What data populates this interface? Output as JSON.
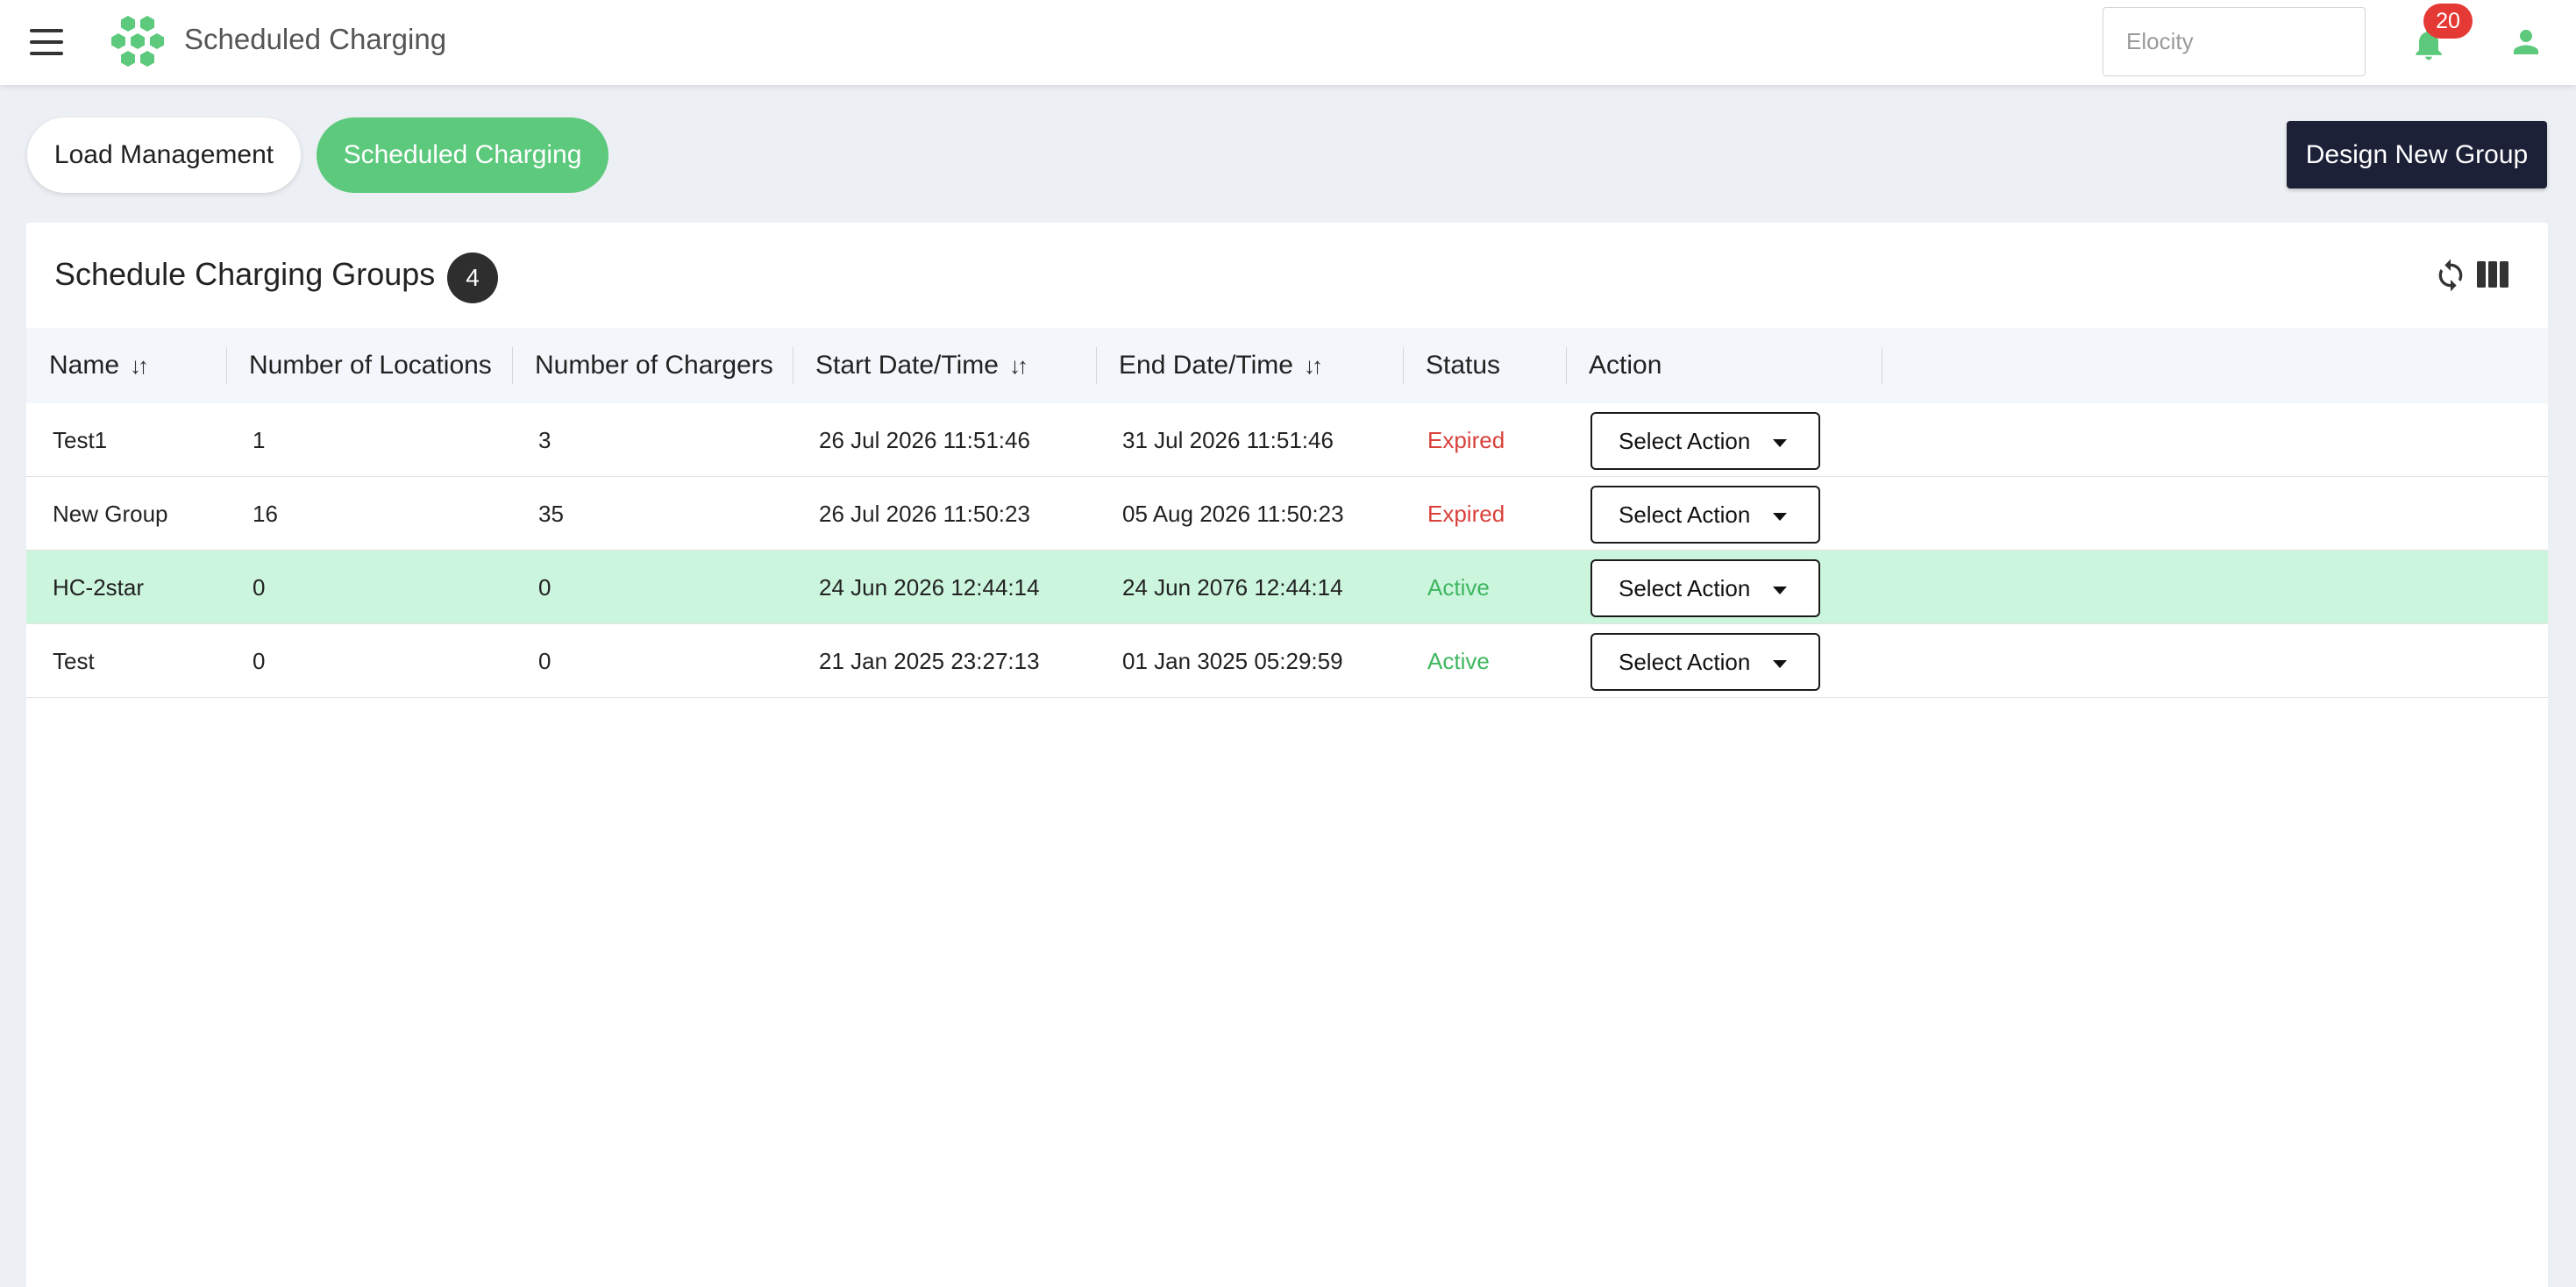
{
  "header": {
    "title": "Scheduled Charging",
    "tenant_placeholder": "Elocity",
    "notification_count": "20",
    "brand_color": "#5cc97c"
  },
  "tabs": [
    {
      "label": "Load Management",
      "active": false
    },
    {
      "label": "Scheduled Charging",
      "active": true
    }
  ],
  "actions": {
    "design_new_group": "Design New Group"
  },
  "card": {
    "title": "Schedule Charging Groups",
    "count": "4"
  },
  "table": {
    "columns": [
      {
        "label": "Name",
        "sortable": true
      },
      {
        "label": "Number of Locations",
        "sortable": false
      },
      {
        "label": "Number of Chargers",
        "sortable": false
      },
      {
        "label": "Start Date/Time",
        "sortable": true
      },
      {
        "label": "End Date/Time",
        "sortable": true
      },
      {
        "label": "Status",
        "sortable": false
      },
      {
        "label": "Action",
        "sortable": false
      }
    ],
    "sort_glyph": "↓↑",
    "rows": [
      {
        "name": "Test1",
        "locations": "1",
        "chargers": "3",
        "start": "26 Jul 2026 11:51:46",
        "end": "31 Jul 2026 11:51:46",
        "status": "Expired",
        "action": "Select Action",
        "highlight": false
      },
      {
        "name": "New Group",
        "locations": "16",
        "chargers": "35",
        "start": "26 Jul 2026 11:50:23",
        "end": "05 Aug 2026 11:50:23",
        "status": "Expired",
        "action": "Select Action",
        "highlight": false
      },
      {
        "name": "HC-2star",
        "locations": "0",
        "chargers": "0",
        "start": "24 Jun 2026 12:44:14",
        "end": "24 Jun 2076 12:44:14",
        "status": "Active",
        "action": "Select Action",
        "highlight": true
      },
      {
        "name": "Test",
        "locations": "0",
        "chargers": "0",
        "start": "21 Jan 2025 23:27:13",
        "end": "01 Jan 3025 05:29:59",
        "status": "Active",
        "action": "Select Action",
        "highlight": false
      }
    ]
  },
  "colors": {
    "expired": "#d9413b",
    "active": "#3fb760",
    "row_highlight": "#ccf5de",
    "primary_dark": "#1d2138"
  }
}
